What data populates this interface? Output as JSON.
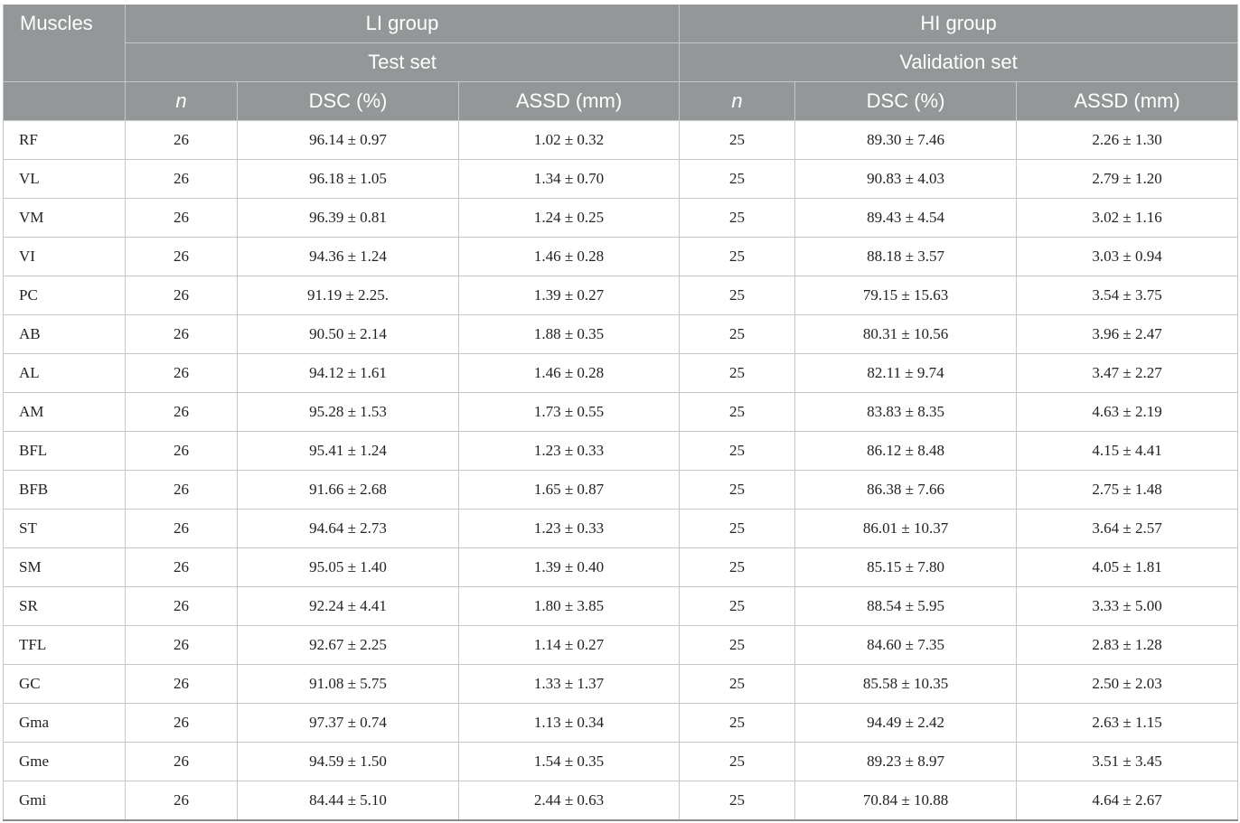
{
  "table": {
    "header": {
      "muscles": "Muscles",
      "group_li": "LI group",
      "group_hi": "HI group",
      "set_li": "Test set",
      "set_hi": "Validation set",
      "col_n": "n",
      "col_dsc": "DSC (%)",
      "col_assd": "ASSD (mm)"
    },
    "rows": [
      {
        "muscle": "RF",
        "li_n": "26",
        "li_dsc": "96.14 ± 0.97",
        "li_assd": "1.02 ± 0.32",
        "hi_n": "25",
        "hi_dsc": "89.30 ± 7.46",
        "hi_assd": "2.26 ± 1.30"
      },
      {
        "muscle": "VL",
        "li_n": "26",
        "li_dsc": "96.18 ± 1.05",
        "li_assd": "1.34 ± 0.70",
        "hi_n": "25",
        "hi_dsc": "90.83 ± 4.03",
        "hi_assd": "2.79 ± 1.20"
      },
      {
        "muscle": "VM",
        "li_n": "26",
        "li_dsc": "96.39 ± 0.81",
        "li_assd": "1.24 ± 0.25",
        "hi_n": "25",
        "hi_dsc": "89.43 ± 4.54",
        "hi_assd": "3.02 ± 1.16"
      },
      {
        "muscle": "VI",
        "li_n": "26",
        "li_dsc": "94.36 ± 1.24",
        "li_assd": "1.46 ± 0.28",
        "hi_n": "25",
        "hi_dsc": "88.18 ± 3.57",
        "hi_assd": "3.03 ± 0.94"
      },
      {
        "muscle": "PC",
        "li_n": "26",
        "li_dsc": "91.19 ± 2.25.",
        "li_assd": "1.39 ± 0.27",
        "hi_n": "25",
        "hi_dsc": "79.15 ± 15.63",
        "hi_assd": "3.54 ± 3.75"
      },
      {
        "muscle": "AB",
        "li_n": "26",
        "li_dsc": "90.50 ± 2.14",
        "li_assd": "1.88 ± 0.35",
        "hi_n": "25",
        "hi_dsc": "80.31 ± 10.56",
        "hi_assd": "3.96 ± 2.47"
      },
      {
        "muscle": "AL",
        "li_n": "26",
        "li_dsc": "94.12 ± 1.61",
        "li_assd": "1.46 ± 0.28",
        "hi_n": "25",
        "hi_dsc": "82.11 ± 9.74",
        "hi_assd": "3.47 ± 2.27"
      },
      {
        "muscle": "AM",
        "li_n": "26",
        "li_dsc": "95.28 ± 1.53",
        "li_assd": "1.73 ± 0.55",
        "hi_n": "25",
        "hi_dsc": "83.83 ± 8.35",
        "hi_assd": "4.63 ± 2.19"
      },
      {
        "muscle": "BFL",
        "li_n": "26",
        "li_dsc": "95.41 ± 1.24",
        "li_assd": "1.23 ± 0.33",
        "hi_n": "25",
        "hi_dsc": "86.12 ± 8.48",
        "hi_assd": "4.15 ± 4.41"
      },
      {
        "muscle": "BFB",
        "li_n": "26",
        "li_dsc": "91.66 ± 2.68",
        "li_assd": "1.65 ± 0.87",
        "hi_n": "25",
        "hi_dsc": "86.38 ± 7.66",
        "hi_assd": "2.75 ± 1.48"
      },
      {
        "muscle": "ST",
        "li_n": "26",
        "li_dsc": "94.64 ± 2.73",
        "li_assd": "1.23 ± 0.33",
        "hi_n": "25",
        "hi_dsc": "86.01 ± 10.37",
        "hi_assd": "3.64 ± 2.57"
      },
      {
        "muscle": "SM",
        "li_n": "26",
        "li_dsc": "95.05 ± 1.40",
        "li_assd": "1.39 ± 0.40",
        "hi_n": "25",
        "hi_dsc": "85.15 ± 7.80",
        "hi_assd": "4.05 ± 1.81"
      },
      {
        "muscle": "SR",
        "li_n": "26",
        "li_dsc": "92.24 ± 4.41",
        "li_assd": "1.80 ± 3.85",
        "hi_n": "25",
        "hi_dsc": "88.54 ± 5.95",
        "hi_assd": "3.33 ± 5.00"
      },
      {
        "muscle": "TFL",
        "li_n": "26",
        "li_dsc": "92.67 ± 2.25",
        "li_assd": "1.14 ± 0.27",
        "hi_n": "25",
        "hi_dsc": "84.60 ± 7.35",
        "hi_assd": "2.83 ± 1.28"
      },
      {
        "muscle": "GC",
        "li_n": "26",
        "li_dsc": "91.08 ± 5.75",
        "li_assd": "1.33 ± 1.37",
        "hi_n": "25",
        "hi_dsc": "85.58 ± 10.35",
        "hi_assd": "2.50 ± 2.03"
      },
      {
        "muscle": "Gma",
        "li_n": "26",
        "li_dsc": "97.37 ± 0.74",
        "li_assd": "1.13 ± 0.34",
        "hi_n": "25",
        "hi_dsc": "94.49 ± 2.42",
        "hi_assd": "2.63 ± 1.15"
      },
      {
        "muscle": "Gme",
        "li_n": "26",
        "li_dsc": "94.59 ± 1.50",
        "li_assd": "1.54 ± 0.35",
        "hi_n": "25",
        "hi_dsc": "89.23 ± 8.97",
        "hi_assd": "3.51 ± 3.45"
      },
      {
        "muscle": "Gmi",
        "li_n": "26",
        "li_dsc": "84.44 ± 5.10",
        "li_assd": "2.44 ± 0.63",
        "hi_n": "25",
        "hi_dsc": "70.84 ± 10.88",
        "hi_assd": "4.64 ± 2.67"
      }
    ]
  }
}
